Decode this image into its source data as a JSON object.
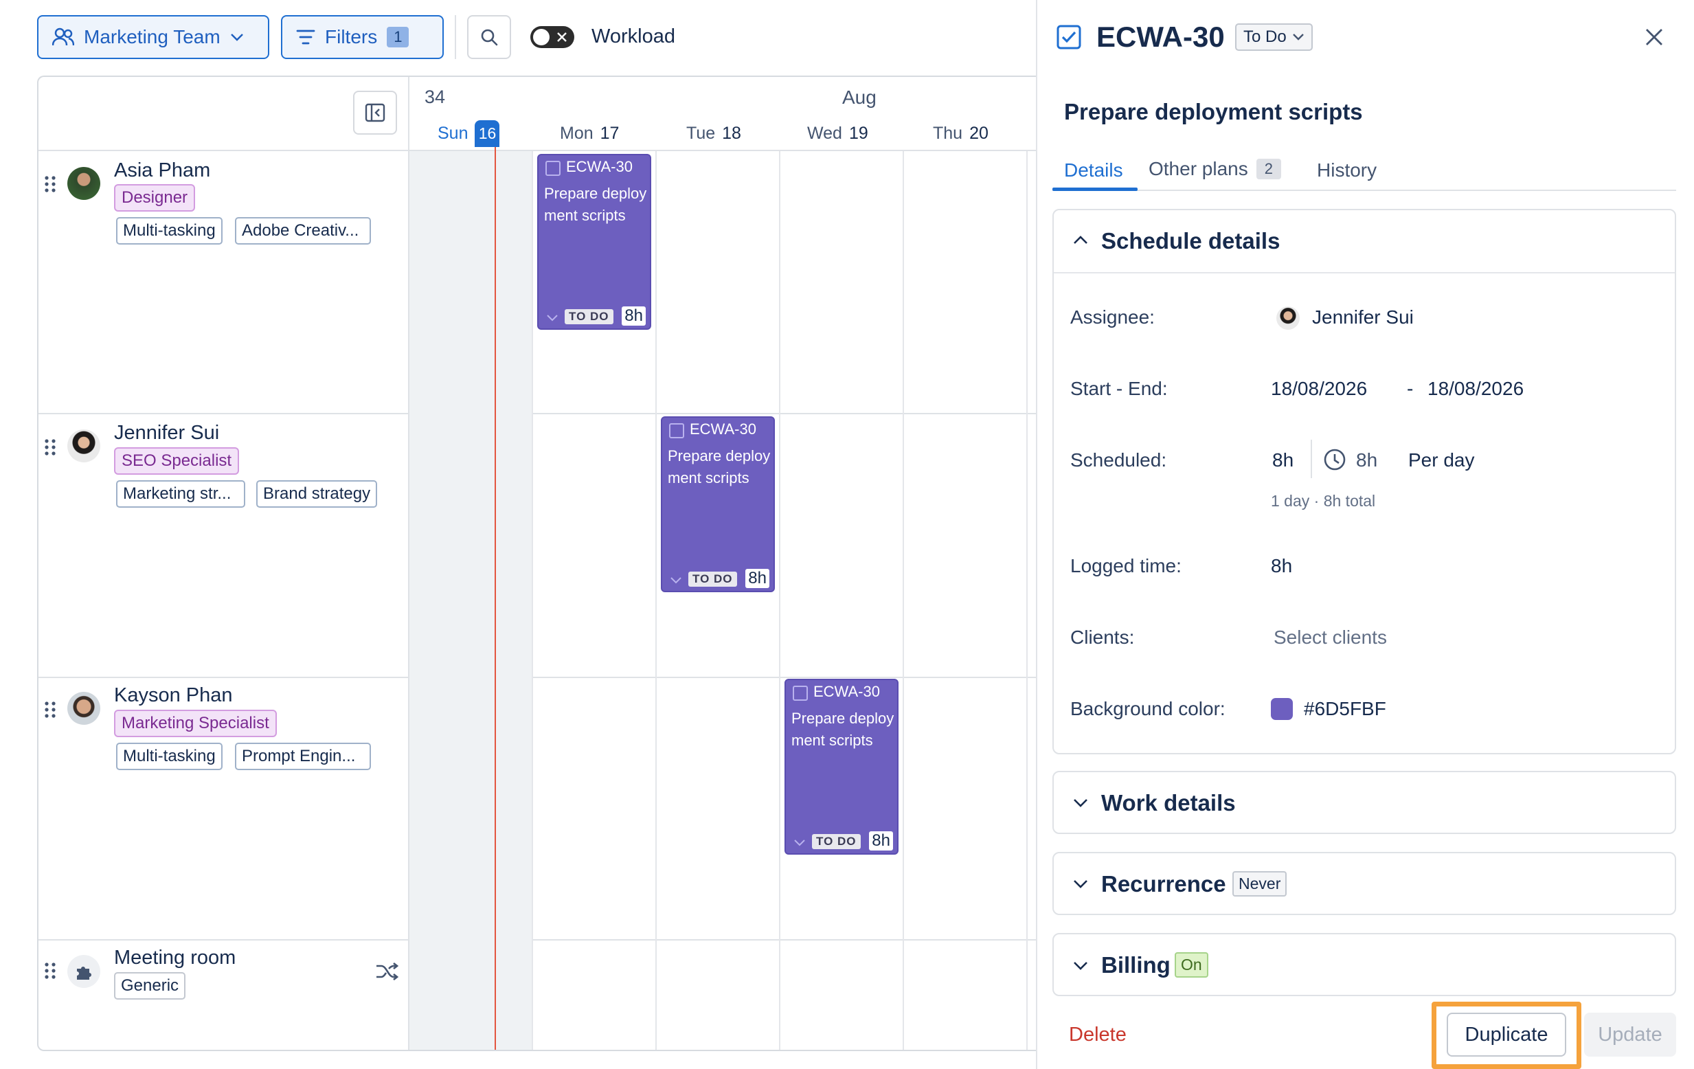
{
  "toolbar": {
    "team_label": "Marketing Team",
    "filters_label": "Filters",
    "filters_count": "1",
    "workload_label": "Workload"
  },
  "calendar": {
    "week_number": "34",
    "month_label": "Aug",
    "days": [
      {
        "name": "Sun",
        "num": "16",
        "today": true
      },
      {
        "name": "Mon",
        "num": "17"
      },
      {
        "name": "Tue",
        "num": "18"
      },
      {
        "name": "Wed",
        "num": "19"
      },
      {
        "name": "Thu",
        "num": "20"
      }
    ]
  },
  "people": [
    {
      "name": "Asia Pham",
      "role": "Designer",
      "tags": [
        "Multi-tasking",
        "Adobe Creativ..."
      ]
    },
    {
      "name": "Jennifer Sui",
      "role": "SEO Specialist",
      "tags": [
        "Marketing str...",
        "Brand strategy"
      ]
    },
    {
      "name": "Kayson Phan",
      "role": "Marketing Specialist",
      "tags": [
        "Multi-tasking",
        "Prompt Engin..."
      ]
    },
    {
      "name": "Meeting room",
      "role": "Generic",
      "tags": []
    }
  ],
  "task_card": {
    "code": "ECWA-30",
    "title": "Prepare deployment scripts",
    "status": "TO DO",
    "hours": "8h",
    "color": "#6D5FBF"
  },
  "panel": {
    "issue_key": "ECWA-30",
    "status_label": "To Do",
    "title": "Prepare deployment scripts",
    "tabs": {
      "details": "Details",
      "other_plans": "Other plans",
      "other_plans_count": "2",
      "history": "History"
    },
    "schedule": {
      "heading": "Schedule details",
      "assignee_label": "Assignee:",
      "assignee_value": "Jennifer Sui",
      "start_end_label": "Start - End:",
      "start_date": "18/08/2026",
      "date_sep": "-",
      "end_date": "18/08/2026",
      "scheduled_label": "Scheduled:",
      "scheduled_hours": "8h",
      "per_day_hours": "8h",
      "per_day_label": "Per day",
      "scheduled_summary": "1 day · 8h total",
      "logged_label": "Logged time:",
      "logged_value": "8h",
      "clients_label": "Clients:",
      "clients_placeholder": "Select clients",
      "bg_color_label": "Background color:",
      "bg_color_value": "#6D5FBF"
    },
    "work_details": "Work details",
    "recurrence": {
      "label": "Recurrence",
      "badge": "Never"
    },
    "billing": {
      "label": "Billing",
      "badge": "On"
    },
    "footer": {
      "delete": "Delete",
      "duplicate": "Duplicate",
      "update": "Update"
    }
  },
  "colors": {
    "accent": "#1F6FD1",
    "today_line": "#E3553F",
    "highlight": "#F5A23C",
    "delete": "#C9372C"
  }
}
